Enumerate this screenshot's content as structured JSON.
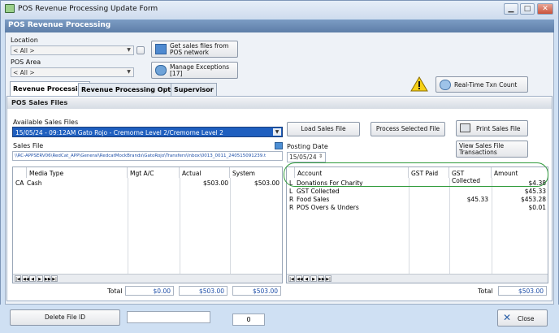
{
  "window": {
    "title": "POS Revenue Processing Update Form",
    "min": "▁",
    "max": "□",
    "close": "✕"
  },
  "header": {
    "title": "POS Revenue Processing"
  },
  "filters": {
    "location_label": "Location",
    "location_value": "< All >",
    "pos_area_label": "POS Area",
    "pos_area_value": "< All >"
  },
  "actions": {
    "get_sales_files": "Get sales files from POS network",
    "manage_exceptions": "Manage Exceptions [17]",
    "realtime": "Real-Time Txn Count"
  },
  "tabs": [
    "Revenue Processing",
    "Revenue Processing Options",
    "Supervisor"
  ],
  "section": {
    "title": "POS Sales Files"
  },
  "sales_files": {
    "available_label": "Available Sales Files",
    "selected": "15/05/24 - 09:12AM  Gato Rojo - Cremorne Level 2/Cremorne Level 2",
    "sales_file_label": "Sales File",
    "path": "\\\\RC-APPSERV06\\RedCat_APP\\General\\RedcatMockBrands\\GatoRojo\\Transfers\\Inbox\\0013_0011_240515091239.t",
    "posting_label": "Posting Date",
    "posting_date": "15/05/24"
  },
  "buttons": {
    "load": "Load Sales File",
    "process": "Process Selected File",
    "print": "Print Sales File",
    "view": "View Sales File Transactions",
    "delete": "Delete File ID",
    "close": "Close"
  },
  "media_grid": {
    "columns": [
      "Media Type",
      "Mgt A/C",
      "Actual",
      "System"
    ],
    "rows": [
      {
        "code": "CA",
        "media": "Cash",
        "mgt": "",
        "actual": "$503.00",
        "system": "$503.00"
      }
    ],
    "total_label": "Total",
    "totals": [
      "$0.00",
      "$503.00",
      "$503.00"
    ]
  },
  "account_grid": {
    "columns": [
      "Account",
      "GST Paid",
      "GST Collected",
      "Amount"
    ],
    "rows": [
      {
        "code": "L",
        "account": "Donations For Charity",
        "gst_paid": "",
        "gst_collected": "",
        "amount": "$4.38"
      },
      {
        "code": "L",
        "account": "GST Collected",
        "gst_paid": "",
        "gst_collected": "",
        "amount": "$45.33"
      },
      {
        "code": "R",
        "account": "Food Sales",
        "gst_paid": "",
        "gst_collected": "$45.33",
        "amount": "$453.28"
      },
      {
        "code": "R",
        "account": "POS Overs & Unders",
        "gst_paid": "",
        "gst_collected": "",
        "amount": "$0.01"
      }
    ],
    "total_label": "Total",
    "total": "$503.00"
  },
  "footer": {
    "delete_id_value": "",
    "count": "0"
  },
  "nav_glyphs": [
    "|◀",
    "◀◀",
    "◀",
    "▶",
    "▶▶",
    "▶|"
  ],
  "colors": {
    "header_blue": "#5d7ea8",
    "highlight_green": "#2e9a3a",
    "selection_blue": "#1f5fbf",
    "total_blue": "#1e4fa8"
  }
}
